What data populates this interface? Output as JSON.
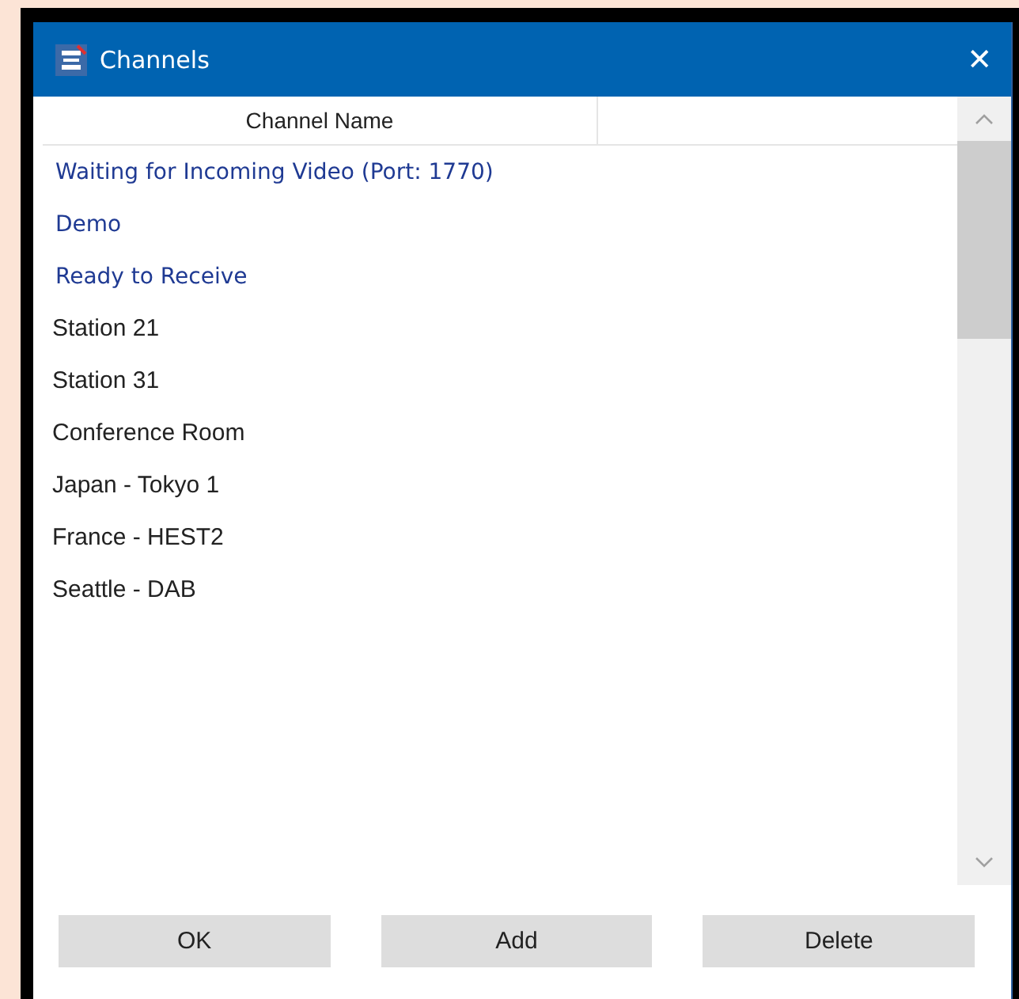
{
  "window": {
    "title": "Channels",
    "close": "✕"
  },
  "table": {
    "columns": [
      "Channel Name"
    ],
    "rows": [
      {
        "name": "Waiting for Incoming Video (Port: 1770)",
        "kind": "status"
      },
      {
        "name": "Demo",
        "kind": "status"
      },
      {
        "name": "Ready to Receive",
        "kind": "status"
      },
      {
        "name": "Station 21",
        "kind": "channel"
      },
      {
        "name": "Station 31",
        "kind": "channel"
      },
      {
        "name": "Conference Room",
        "kind": "channel"
      },
      {
        "name": "Japan - Tokyo 1",
        "kind": "channel"
      },
      {
        "name": "France - HEST2",
        "kind": "channel"
      },
      {
        "name": "Seattle - DAB",
        "kind": "channel"
      }
    ]
  },
  "buttons": [
    "OK",
    "Add",
    "Delete"
  ]
}
